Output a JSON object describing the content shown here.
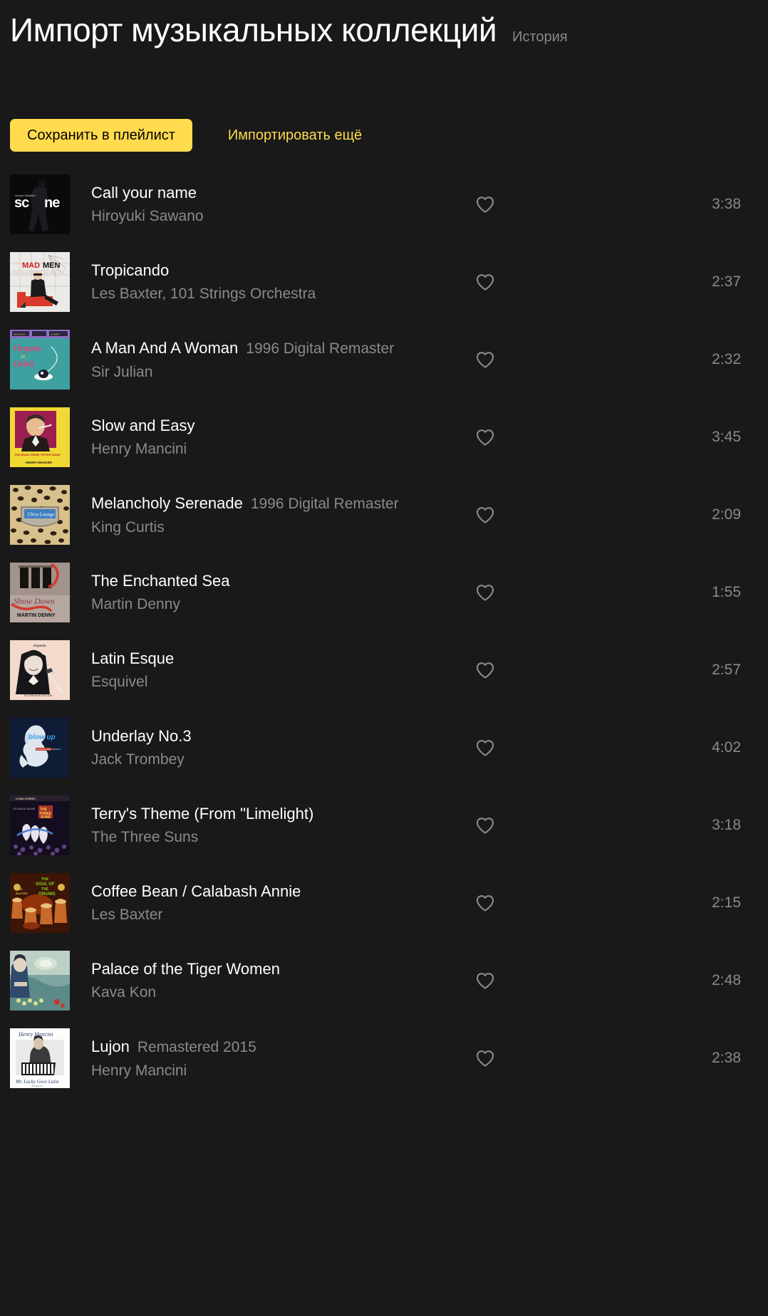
{
  "header": {
    "title": "Импорт музыкальных коллекций",
    "history_label": "История"
  },
  "actions": {
    "save_label": "Сохранить в плейлист",
    "import_more_label": "Импортировать ещё"
  },
  "colors": {
    "background": "#191919",
    "accent": "#ffdb4d",
    "primary_text": "#ffffff",
    "secondary_text": "#8a8a8a"
  },
  "icons": {
    "like": "heart-outline-icon"
  },
  "tracks": [
    {
      "title": "Call your name",
      "version": "",
      "artist": "Hiroyuki Sawano",
      "duration": "3:38",
      "cover": {
        "bg": "#0a0a0c",
        "style": "scene"
      }
    },
    {
      "title": "Tropicando",
      "version": "",
      "artist": "Les Baxter, 101 Strings Orchestra",
      "duration": "2:37",
      "cover": {
        "bg": "#e8e6e2",
        "style": "madmen"
      }
    },
    {
      "title": "A Man And A Woman",
      "version": "1996 Digital Remaster",
      "artist": "Sir Julian",
      "duration": "2:32",
      "cover": {
        "bg": "#3fa0a0",
        "style": "organs"
      }
    },
    {
      "title": "Slow and Easy",
      "version": "",
      "artist": "Henry Mancini",
      "duration": "3:45",
      "cover": {
        "bg": "#f2d832",
        "style": "mancini-yellow"
      }
    },
    {
      "title": "Melancholy Serenade",
      "version": "1996 Digital Remaster",
      "artist": "King Curtis",
      "duration": "2:09",
      "cover": {
        "bg": "#d9c18a",
        "style": "leopard"
      }
    },
    {
      "title": "The Enchanted Sea",
      "version": "",
      "artist": "Martin Denny",
      "duration": "1:55",
      "cover": {
        "bg": "#b9a9a3",
        "style": "showdown"
      }
    },
    {
      "title": "Latin Esque",
      "version": "",
      "artist": "Esquivel",
      "duration": "2:57",
      "cover": {
        "bg": "#f2d9cc",
        "style": "esquivel"
      }
    },
    {
      "title": "Underlay No.3",
      "version": "",
      "artist": "Jack Trombey",
      "duration": "4:02",
      "cover": {
        "bg": "#0d1b33",
        "style": "blowup"
      }
    },
    {
      "title": "Terry's Theme (From \"Limelight)",
      "version": "",
      "artist": "The Three Suns",
      "duration": "3:18",
      "cover": {
        "bg": "#120c1c",
        "style": "threesuns"
      }
    },
    {
      "title": "Coffee Bean / Calabash Annie",
      "version": "",
      "artist": "Les Baxter",
      "duration": "2:15",
      "cover": {
        "bg": "#3a1608",
        "style": "souldrums"
      }
    },
    {
      "title": "Palace of the Tiger Women",
      "version": "",
      "artist": "Kava Kon",
      "duration": "2:48",
      "cover": {
        "bg": "#b9cfb2",
        "style": "kavakon"
      }
    },
    {
      "title": "Lujon",
      "version": "Remastered 2015",
      "artist": "Henry Mancini",
      "duration": "2:38",
      "cover": {
        "bg": "#ffffff",
        "style": "mrlucky"
      }
    }
  ]
}
